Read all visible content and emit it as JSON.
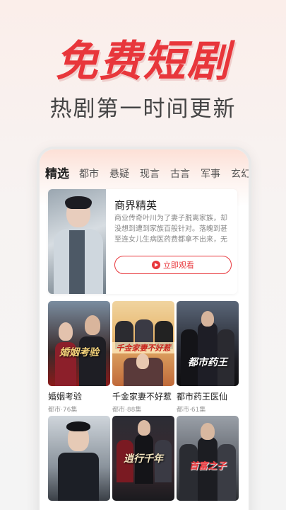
{
  "hero": {
    "title": "免费短剧",
    "subtitle": "热剧第一时间更新"
  },
  "tabs": [
    "精选",
    "都市",
    "悬疑",
    "现言",
    "古言",
    "军事",
    "玄幻"
  ],
  "feature": {
    "title": "商界精英",
    "description": "商业传奇叶川为了妻子脱离家族，却没想到遭到家族百般针对。落魄到甚至连女儿生病医药费都拿不出来，无奈之下...",
    "button": "立即观看"
  },
  "dramas": [
    {
      "title": "婚姻考验",
      "meta": "都市·76集",
      "poster_text": "婚姻考验"
    },
    {
      "title": "千金家妻不好惹",
      "meta": "都市·88集",
      "poster_text": "千金家妻不好惹"
    },
    {
      "title": "都市药王医仙",
      "meta": "都市·61集",
      "poster_text": "都市药王"
    },
    {
      "title": "",
      "meta": "",
      "poster_text": ""
    },
    {
      "title": "",
      "meta": "",
      "poster_text": "逍行千年"
    },
    {
      "title": "",
      "meta": "",
      "poster_text": "首富之子"
    }
  ],
  "colors": {
    "accent": "#e8363b"
  }
}
